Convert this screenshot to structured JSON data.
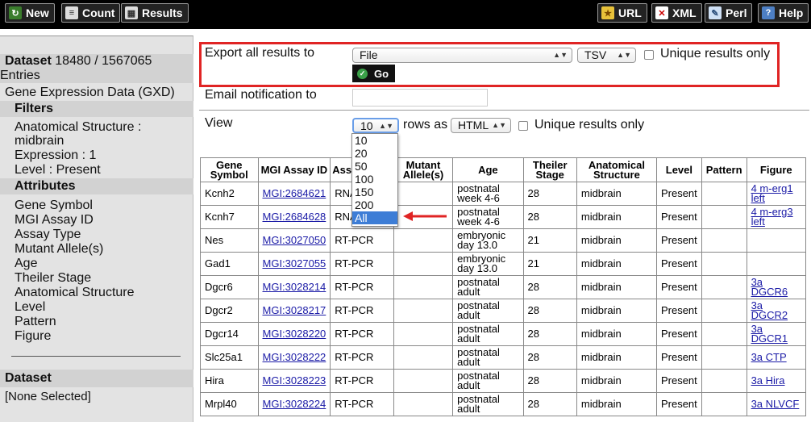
{
  "toolbar": {
    "left": [
      {
        "label": "New",
        "icon": "refresh-icon"
      },
      {
        "label": "Count",
        "icon": "list-icon"
      },
      {
        "label": "Results",
        "icon": "table-icon"
      }
    ],
    "right": [
      {
        "label": "URL",
        "icon": "star-icon"
      },
      {
        "label": "XML",
        "icon": "xml-icon"
      },
      {
        "label": "Perl",
        "icon": "script-icon"
      },
      {
        "label": "Help",
        "icon": "help-icon"
      }
    ]
  },
  "sidebar": {
    "dataset_label": "Dataset",
    "dataset_count": "18480 / 1567065",
    "entries_label": "Entries",
    "source": "Gene Expression Data (GXD)",
    "filters_heading": "Filters",
    "filters": [
      "Anatomical Structure :",
      "midbrain",
      "Expression : 1",
      "Level : Present"
    ],
    "attributes_heading": "Attributes",
    "attributes": [
      "Gene Symbol",
      "MGI Assay ID",
      "Assay Type",
      "Mutant Allele(s)",
      "Age",
      "Theiler Stage",
      "Anatomical Structure",
      "Level",
      "Pattern",
      "Figure"
    ],
    "dataset2_heading": "Dataset",
    "dataset2_value": "[None Selected]"
  },
  "export": {
    "label": "Export  all results to",
    "destination": "File",
    "format": "TSV",
    "unique_label": "Unique results only",
    "go_label": "Go"
  },
  "email": {
    "label": "Email notification to",
    "value": ""
  },
  "view": {
    "label": "View",
    "rows_value": "10",
    "rows_as_label": "rows as",
    "format": "HTML",
    "unique_label": "Unique results only",
    "rows_options": [
      "10",
      "20",
      "50",
      "100",
      "150",
      "200",
      "All"
    ],
    "highlighted_option": "All"
  },
  "table": {
    "headers": [
      "Gene Symbol",
      "MGI Assay ID",
      "Assay Type",
      "Mutant Allele(s)",
      "Age",
      "Theiler Stage",
      "Anatomical Structure",
      "Level",
      "Pattern",
      "Figure"
    ],
    "header_visible": [
      "Gene Symbol",
      "MGI Assay ID",
      "Ass",
      "Mutant Allele(s)",
      "Age",
      "Theiler Stage",
      "Anatomical Structure",
      "Level",
      "Pattern",
      "Figure"
    ],
    "rows": [
      {
        "gene": "Kcnh2",
        "mgi": "MGI:2684621",
        "assay": "RNA protein",
        "assay_visible": "RNA prot",
        "mutant": "",
        "age": "postnatal week 4-6",
        "stage": "28",
        "structure": "midbrain",
        "level": "Present",
        "pattern": "",
        "figure": "4 m-erg1 left"
      },
      {
        "gene": "Kcnh7",
        "mgi": "MGI:2684628",
        "assay": "RNA protein",
        "assay_visible": "RNA prot",
        "mutant": "",
        "age": "postnatal week 4-6",
        "stage": "28",
        "structure": "midbrain",
        "level": "Present",
        "pattern": "",
        "figure": "4 m-erg3 left"
      },
      {
        "gene": "Nes",
        "mgi": "MGI:3027050",
        "assay": "RT-PCR",
        "assay_visible": "RT-PCR",
        "mutant": "",
        "age": "embryonic day 13.0",
        "stage": "21",
        "structure": "midbrain",
        "level": "Present",
        "pattern": "",
        "figure": ""
      },
      {
        "gene": "Gad1",
        "mgi": "MGI:3027055",
        "assay": "RT-PCR",
        "assay_visible": "RT-PCR",
        "mutant": "",
        "age": "embryonic day 13.0",
        "stage": "21",
        "structure": "midbrain",
        "level": "Present",
        "pattern": "",
        "figure": ""
      },
      {
        "gene": "Dgcr6",
        "mgi": "MGI:3028214",
        "assay": "RT-PCR",
        "assay_visible": "RT-PCR",
        "mutant": "",
        "age": "postnatal adult",
        "stage": "28",
        "structure": "midbrain",
        "level": "Present",
        "pattern": "",
        "figure": "3a DGCR6"
      },
      {
        "gene": "Dgcr2",
        "mgi": "MGI:3028217",
        "assay": "RT-PCR",
        "assay_visible": "RT-PCR",
        "mutant": "",
        "age": "postnatal adult",
        "stage": "28",
        "structure": "midbrain",
        "level": "Present",
        "pattern": "",
        "figure": "3a DGCR2"
      },
      {
        "gene": "Dgcr14",
        "mgi": "MGI:3028220",
        "assay": "RT-PCR",
        "assay_visible": "RT-PCR",
        "mutant": "",
        "age": "postnatal adult",
        "stage": "28",
        "structure": "midbrain",
        "level": "Present",
        "pattern": "",
        "figure": "3a DGCR1"
      },
      {
        "gene": "Slc25a1",
        "mgi": "MGI:3028222",
        "assay": "RT-PCR",
        "assay_visible": "RT-PCR",
        "mutant": "",
        "age": "postnatal adult",
        "stage": "28",
        "structure": "midbrain",
        "level": "Present",
        "pattern": "",
        "figure": "3a CTP"
      },
      {
        "gene": "Hira",
        "mgi": "MGI:3028223",
        "assay": "RT-PCR",
        "assay_visible": "RT-PCR",
        "mutant": "",
        "age": "postnatal adult",
        "stage": "28",
        "structure": "midbrain",
        "level": "Present",
        "pattern": "",
        "figure": "3a Hira"
      },
      {
        "gene": "Mrpl40",
        "mgi": "MGI:3028224",
        "assay": "RT-PCR",
        "assay_visible": "RT-PCR",
        "mutant": "",
        "age": "postnatal adult",
        "stage": "28",
        "structure": "midbrain",
        "level": "Present",
        "pattern": "",
        "figure": "3a NLVCF"
      }
    ]
  },
  "colors": {
    "highlight_border": "#e02424",
    "link": "#1a1aa6",
    "selected_option": "#3d7dd6",
    "go_icon": "#3aa048"
  }
}
